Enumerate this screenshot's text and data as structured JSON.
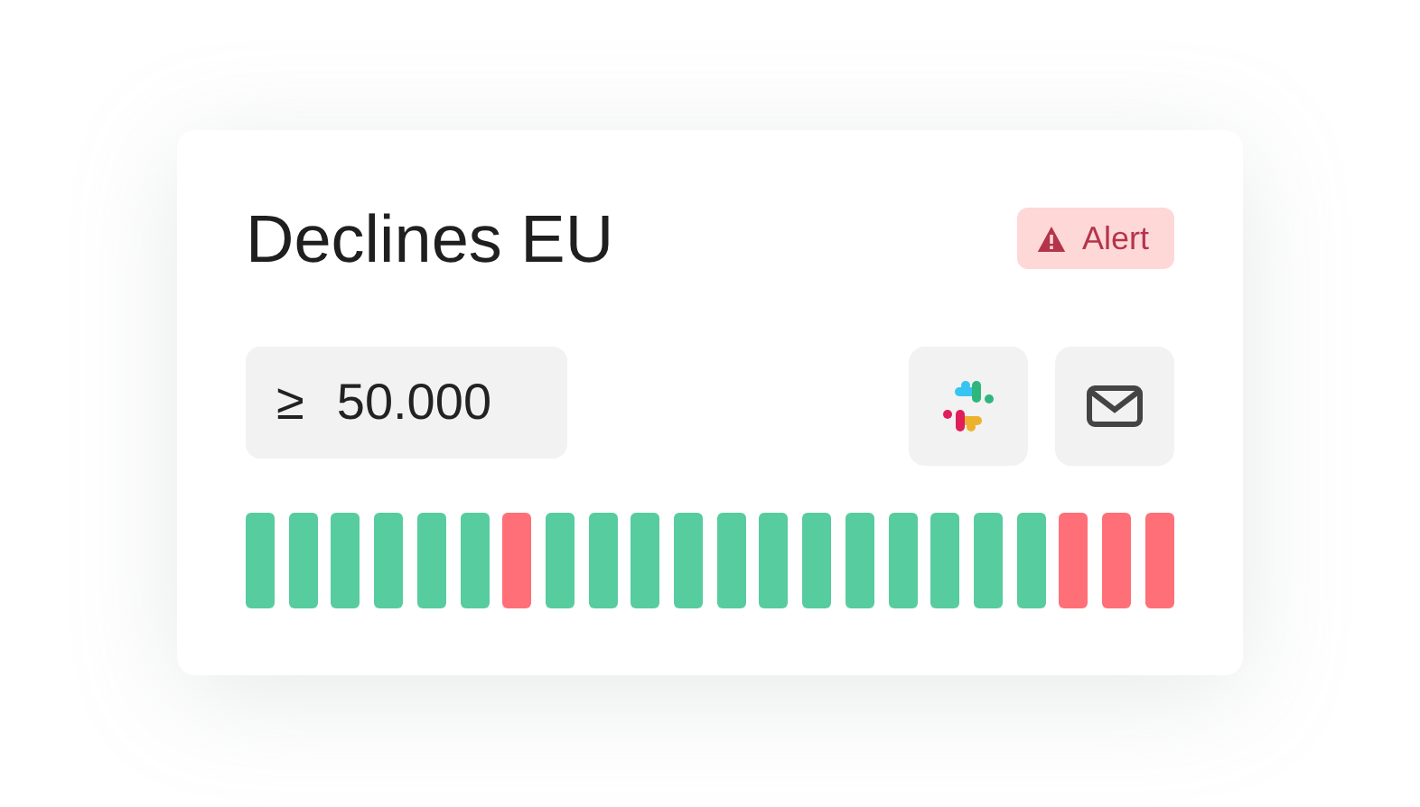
{
  "monitor": {
    "title": "Declines EU",
    "badge": {
      "label": "Alert"
    },
    "threshold": {
      "symbol": "≥",
      "value": "50.000"
    },
    "actions": [
      {
        "kind": "slack"
      },
      {
        "kind": "email"
      }
    ],
    "history": [
      {
        "color": "#57cc9f"
      },
      {
        "color": "#57cc9f"
      },
      {
        "color": "#57cc9f"
      },
      {
        "color": "#57cc9f"
      },
      {
        "color": "#57cc9f"
      },
      {
        "color": "#57cc9f"
      },
      {
        "color": "#ff6f77"
      },
      {
        "color": "#57cc9f"
      },
      {
        "color": "#57cc9f"
      },
      {
        "color": "#57cc9f"
      },
      {
        "color": "#57cc9f"
      },
      {
        "color": "#57cc9f"
      },
      {
        "color": "#57cc9f"
      },
      {
        "color": "#57cc9f"
      },
      {
        "color": "#57cc9f"
      },
      {
        "color": "#57cc9f"
      },
      {
        "color": "#57cc9f"
      },
      {
        "color": "#57cc9f"
      },
      {
        "color": "#57cc9f"
      },
      {
        "color": "#ff6f77"
      },
      {
        "color": "#ff6f77"
      },
      {
        "color": "#ff6f77"
      }
    ]
  }
}
